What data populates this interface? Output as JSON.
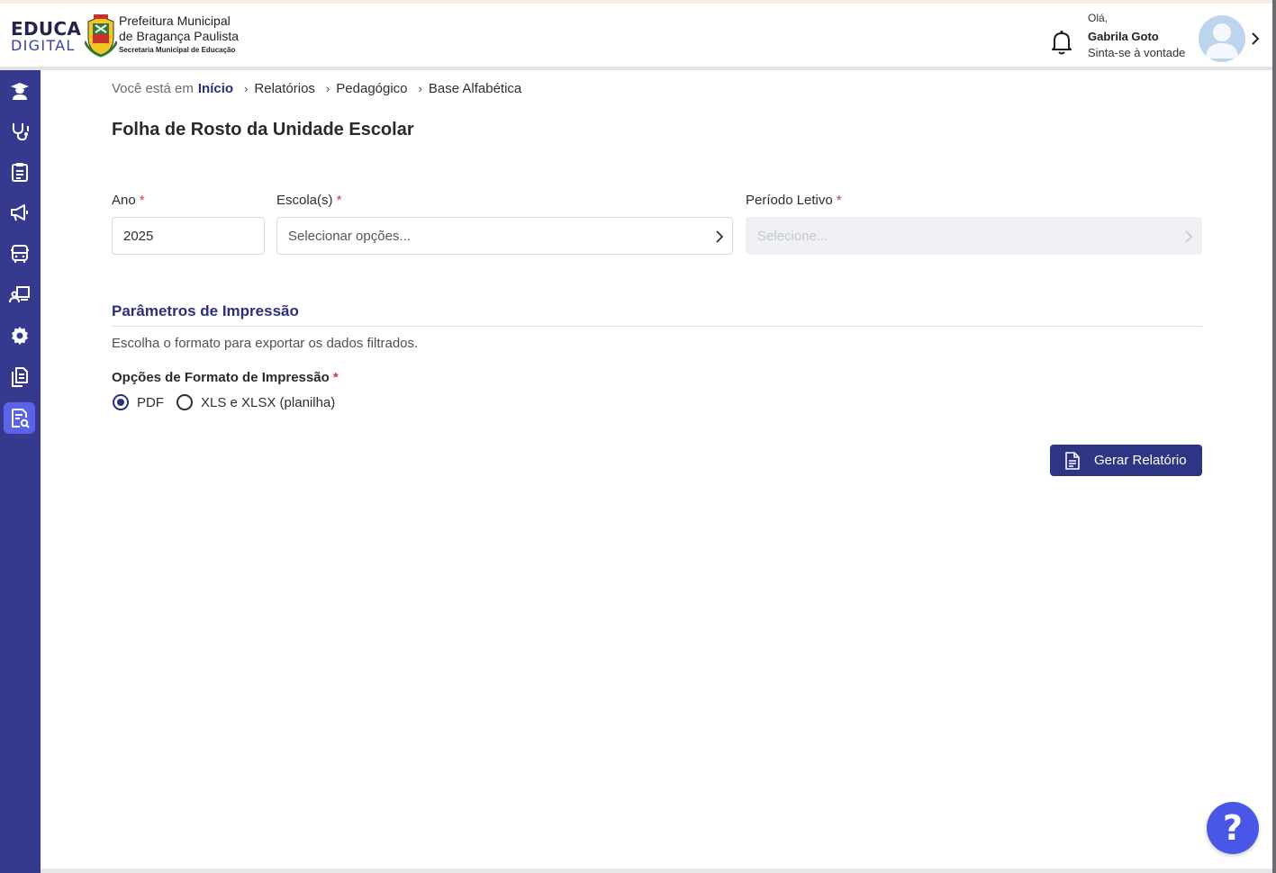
{
  "header": {
    "logo_line1": "EDUCA",
    "logo_line2": "DIGITAL",
    "prefeitura_line1": "Prefeitura Municipal",
    "prefeitura_line2": "de Bragança Paulista",
    "secretaria": "Secretaria Municipal de Educação",
    "greeting": "Olá,",
    "user_name": "Gabrila Goto",
    "user_subtitle": "Sinta-se à vontade"
  },
  "sidebar": {
    "items": [
      {
        "icon": "graduation-teacher-icon"
      },
      {
        "icon": "stethoscope-icon"
      },
      {
        "icon": "clipboard-icon"
      },
      {
        "icon": "megaphone-icon"
      },
      {
        "icon": "bus-icon"
      },
      {
        "icon": "teacher-board-icon"
      },
      {
        "icon": "gear-icon"
      },
      {
        "icon": "documents-icon"
      },
      {
        "icon": "report-search-icon",
        "active": true
      }
    ]
  },
  "breadcrumb": {
    "prefix": "Você está em",
    "home": "Início",
    "items": [
      "Relatórios",
      "Pedagógico",
      "Base Alfabética"
    ]
  },
  "page": {
    "title": "Folha de Rosto da Unidade Escolar"
  },
  "form": {
    "ano": {
      "label": "Ano",
      "required_mark": "*",
      "value": "2025"
    },
    "escolas": {
      "label": "Escola(s)",
      "required_mark": "*",
      "placeholder": "Selecionar opções..."
    },
    "periodo": {
      "label": "Período Letivo",
      "required_mark": "*",
      "placeholder": "Selecione...",
      "disabled": true
    }
  },
  "print_params": {
    "title": "Parâmetros de Impressão",
    "description": "Escolha o formato para exportar os dados filtrados.",
    "options_label": "Opções de Formato de Impressão",
    "required_mark": "*",
    "options": [
      {
        "label": "PDF",
        "selected": true
      },
      {
        "label": "XLS e XLSX (planilha)",
        "selected": false
      }
    ]
  },
  "actions": {
    "generate_label": "Gerar Relatório"
  },
  "help": {
    "symbol": "?"
  },
  "colors": {
    "sidebar": "#363a8e",
    "sidebar_active": "#5b64e8",
    "primary": "#2f3585",
    "required": "#d9363e",
    "help_button": "#4a57e6"
  }
}
